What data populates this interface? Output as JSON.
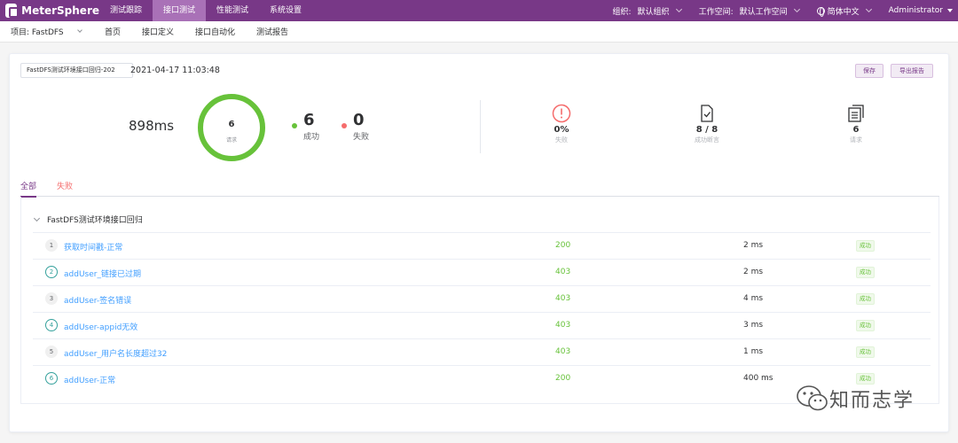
{
  "app": {
    "brand": "MeterSphere"
  },
  "topnav": {
    "items": [
      {
        "label": "测试跟踪",
        "active": false
      },
      {
        "label": "接口测试",
        "active": true
      },
      {
        "label": "性能测试",
        "active": false
      },
      {
        "label": "系统设置",
        "active": false
      }
    ],
    "org_label": "组织:",
    "org_value": "默认组织",
    "workspace_label": "工作空间:",
    "workspace_value": "默认工作空间",
    "language": "简体中文",
    "user": "Administrator"
  },
  "subnav": {
    "project": "项目: FastDFS",
    "items": [
      "首页",
      "接口定义",
      "接口自动化",
      "测试报告"
    ]
  },
  "report": {
    "name": "FastDFS测试环境接口回归-202",
    "time": "2021-04-17 11:03:48",
    "save_label": "保存",
    "export_label": "导出报告",
    "duration": "898ms",
    "total_requests": "6",
    "requests_label": "请求",
    "success_count": "6",
    "success_label": "成功",
    "fail_count": "0",
    "fail_label": "失败",
    "metrics": [
      {
        "icon": "alert-circle-icon",
        "value": "0%",
        "caption": "失败"
      },
      {
        "icon": "checked-document-icon",
        "value": "8 / 8",
        "caption": "成功断言"
      },
      {
        "icon": "documents-icon",
        "value": "6",
        "caption": "请求"
      }
    ]
  },
  "tabs": {
    "all": "全部",
    "fail": "失败"
  },
  "scenario": {
    "name": "FastDFS测试环境接口回归",
    "rows": [
      {
        "index": "1",
        "name": "获取时间戳-正常",
        "code": "200",
        "time": "2 ms",
        "status": "成功"
      },
      {
        "index": "2",
        "name": "addUser_链接已过期",
        "code": "403",
        "time": "2 ms",
        "status": "成功"
      },
      {
        "index": "3",
        "name": "addUser-签名错误",
        "code": "403",
        "time": "4 ms",
        "status": "成功"
      },
      {
        "index": "4",
        "name": "addUser-appid无效",
        "code": "403",
        "time": "3 ms",
        "status": "成功"
      },
      {
        "index": "5",
        "name": "addUser_用户名长度超过32",
        "code": "403",
        "time": "1 ms",
        "status": "成功"
      },
      {
        "index": "6",
        "name": "addUser-正常",
        "code": "200",
        "time": "400 ms",
        "status": "成功"
      }
    ]
  },
  "watermark": "知而志学",
  "colors": {
    "brand": "#783887",
    "success": "#67c23a",
    "fail": "#f56c6c",
    "link": "#409eff"
  }
}
